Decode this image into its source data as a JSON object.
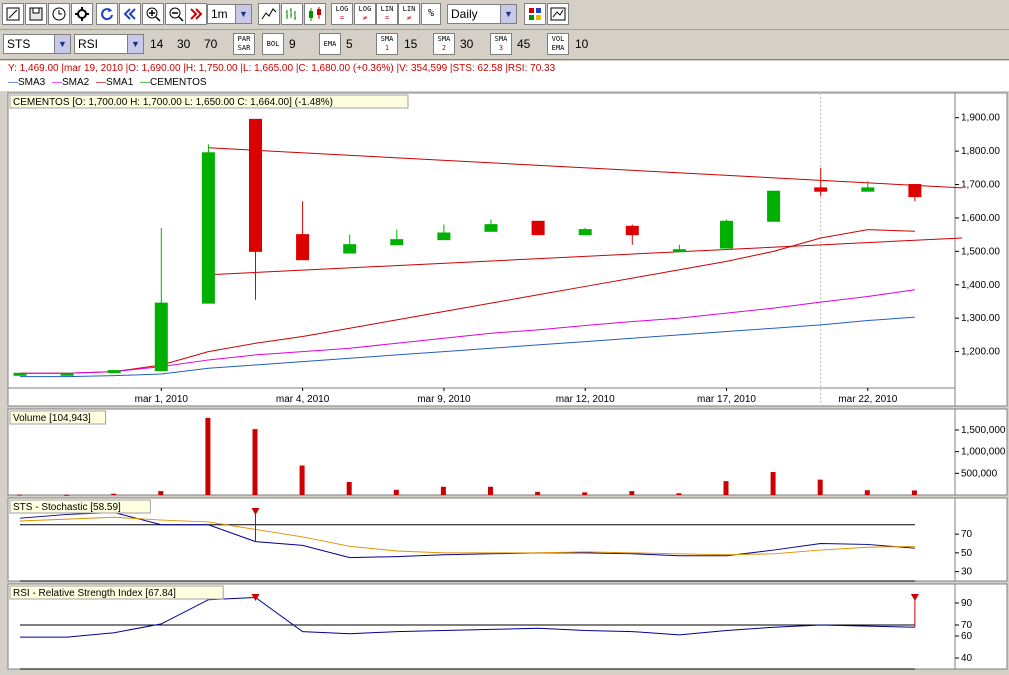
{
  "toolbar1": {
    "interval": "1m",
    "period": "Daily",
    "buttons": [
      "draw-icon",
      "save-icon",
      "clock-icon",
      "settings-icon",
      "refresh-icon",
      "rewind-icon",
      "zoom-in-icon",
      "zoom-out-icon",
      "forward-icon"
    ],
    "chart_type_buttons": [
      "line-chart-icon",
      "bar-chart-icon",
      "candle-chart-icon"
    ],
    "scale_buttons": [
      {
        "top": "LOG",
        "bottom": "="
      },
      {
        "top": "LOG",
        "bottom": "≠"
      },
      {
        "top": "LIN",
        "bottom": "="
      },
      {
        "top": "LIN",
        "bottom": "≠"
      },
      {
        "top": "%",
        "bottom": ""
      }
    ]
  },
  "toolbar2": {
    "symbol": "STS",
    "indicator": "RSI",
    "params": [
      "14",
      "30",
      "70"
    ],
    "par_sar": {
      "top": "PAR",
      "bottom": "SAR"
    },
    "bol": {
      "label": "BOL",
      "value": "9"
    },
    "ema": {
      "label": "EMA",
      "value": "5"
    },
    "sma1": {
      "label": "SMA",
      "num": "1",
      "value": "15"
    },
    "sma2": {
      "label": "SMA",
      "num": "2",
      "value": "30"
    },
    "sma3": {
      "label": "SMA",
      "num": "3",
      "value": "45"
    },
    "vol_ema": {
      "top": "VOL",
      "bottom": "EMA",
      "value": "10"
    }
  },
  "info_line": "Y: 1,469.00 |mar 19, 2010 |O: 1,690.00 |H: 1,750.00 |L: 1,665.00 |C: 1,680.00 (+0.36%) |V: 354,599 |STS: 62.58 |RSI: 70.33",
  "legend": [
    {
      "label": "SMA3",
      "color": "#2060c0"
    },
    {
      "label": "SMA2",
      "color": "#e000e0"
    },
    {
      "label": "SMA1",
      "color": "#cc0000"
    },
    {
      "label": "CEMENTOS",
      "color": "#009000"
    }
  ],
  "chart_data": [
    {
      "type": "candlestick",
      "title": "CEMENTOS [O: 1,700.00  H: 1,700.00  L: 1,650.00  C: 1,664.00] (-1.48%)",
      "x_tick_labels": [
        "mar 1, 2010",
        "mar 4, 2010",
        "mar 9, 2010",
        "mar 12, 2010",
        "mar 17, 2010",
        "mar 22, 2010"
      ],
      "x_tick_index": [
        3,
        6,
        9,
        12,
        15,
        18
      ],
      "y_ticks": [
        1200,
        1300,
        1400,
        1500,
        1600,
        1700,
        1800,
        1900
      ],
      "y_tick_labels": [
        "1,200.00",
        "1,300.00",
        "1,400.00",
        "1,500.00",
        "1,600.00",
        "1,700.00",
        "1,800.00",
        "1,900.00"
      ],
      "ylim": [
        1100,
        1950
      ],
      "candles": [
        {
          "o": 1135,
          "h": 1135,
          "l": 1135,
          "c": 1135
        },
        {
          "o": 1135,
          "h": 1135,
          "l": 1135,
          "c": 1135
        },
        {
          "o": 1138,
          "h": 1145,
          "l": 1135,
          "c": 1143
        },
        {
          "o": 1143,
          "h": 1570,
          "l": 1143,
          "c": 1345
        },
        {
          "o": 1345,
          "h": 1820,
          "l": 1345,
          "c": 1795
        },
        {
          "o": 1895,
          "h": 1895,
          "l": 1355,
          "c": 1500
        },
        {
          "o": 1550,
          "h": 1650,
          "l": 1475,
          "c": 1475
        },
        {
          "o": 1495,
          "h": 1550,
          "l": 1495,
          "c": 1520
        },
        {
          "o": 1520,
          "h": 1565,
          "l": 1520,
          "c": 1535
        },
        {
          "o": 1535,
          "h": 1580,
          "l": 1535,
          "c": 1555
        },
        {
          "o": 1560,
          "h": 1595,
          "l": 1560,
          "c": 1580
        },
        {
          "o": 1590,
          "h": 1590,
          "l": 1550,
          "c": 1550
        },
        {
          "o": 1550,
          "h": 1570,
          "l": 1550,
          "c": 1565
        },
        {
          "o": 1575,
          "h": 1580,
          "l": 1520,
          "c": 1550
        },
        {
          "o": 1500,
          "h": 1520,
          "l": 1500,
          "c": 1505
        },
        {
          "o": 1510,
          "h": 1595,
          "l": 1510,
          "c": 1590
        },
        {
          "o": 1590,
          "h": 1680,
          "l": 1590,
          "c": 1680
        },
        {
          "o": 1690,
          "h": 1750,
          "l": 1665,
          "c": 1680
        },
        {
          "o": 1680,
          "h": 1710,
          "l": 1680,
          "c": 1690
        },
        {
          "o": 1700,
          "h": 1700,
          "l": 1650,
          "c": 1664
        }
      ],
      "series": [
        {
          "name": "SMA1",
          "color": "#cc0000",
          "values": [
            1135,
            1135,
            1140,
            1160,
            1200,
            1225,
            1245,
            1270,
            1295,
            1320,
            1345,
            1370,
            1395,
            1420,
            1445,
            1470,
            1500,
            1540,
            1565,
            1560
          ]
        },
        {
          "name": "SMA2",
          "color": "#e000e0",
          "values": [
            1135,
            1135,
            1140,
            1155,
            1175,
            1190,
            1200,
            1210,
            1225,
            1240,
            1255,
            1265,
            1278,
            1290,
            1300,
            1315,
            1330,
            1348,
            1365,
            1385
          ]
        },
        {
          "name": "SMA3",
          "color": "#2060c0",
          "values": [
            1125,
            1125,
            1128,
            1133,
            1150,
            1160,
            1170,
            1180,
            1190,
            1200,
            1210,
            1220,
            1230,
            1240,
            1250,
            1260,
            1270,
            1280,
            1293,
            1303
          ]
        }
      ],
      "trendlines": [
        {
          "x1": 4,
          "y1": 1810,
          "x2": 20,
          "y2": 1690
        },
        {
          "x1": 4,
          "y1": 1430,
          "x2": 20,
          "y2": 1540
        }
      ]
    },
    {
      "type": "bar",
      "title": "Volume [104,943]",
      "y_ticks": [
        500000,
        1000000,
        1500000
      ],
      "y_tick_labels": [
        "500,000",
        "1,000,000",
        "1,500,000"
      ],
      "ylim": [
        0,
        1800000
      ],
      "values": [
        10000,
        5000,
        30000,
        90000,
        1780000,
        1520000,
        680000,
        300000,
        120000,
        190000,
        190000,
        70000,
        60000,
        90000,
        40000,
        320000,
        530000,
        354599,
        110000,
        104943
      ]
    },
    {
      "type": "line",
      "title": "STS - Stochastic [58.59]",
      "y_ticks": [
        30,
        50,
        70
      ],
      "ylim": [
        20,
        100
      ],
      "reference_line": 80,
      "series": [
        {
          "name": "%K",
          "color": "#000090",
          "values": [
            87,
            91,
            93,
            80,
            80,
            62,
            58,
            45,
            46,
            48,
            49,
            50,
            50,
            49,
            47,
            47,
            53,
            60,
            59,
            55
          ]
        },
        {
          "name": "%D",
          "color": "#e09000",
          "values": [
            84,
            86,
            88,
            85,
            83,
            75,
            67,
            57,
            52,
            50,
            50,
            50,
            51,
            50,
            49,
            48,
            49,
            53,
            56,
            57
          ]
        }
      ],
      "markers": [
        5
      ]
    },
    {
      "type": "line",
      "title": "RSI - Relative Strength Index [67.84]",
      "y_ticks": [
        40,
        60,
        70,
        90
      ],
      "ylim": [
        30,
        100
      ],
      "reference_lines": [
        70
      ],
      "series": [
        {
          "name": "RSI",
          "color": "#000090",
          "values": [
            59,
            59,
            63,
            71,
            93,
            95,
            64,
            62,
            64,
            65,
            66,
            67,
            65,
            64,
            61,
            65,
            68,
            70,
            69,
            68
          ]
        }
      ],
      "markers": [
        5,
        19
      ]
    }
  ]
}
